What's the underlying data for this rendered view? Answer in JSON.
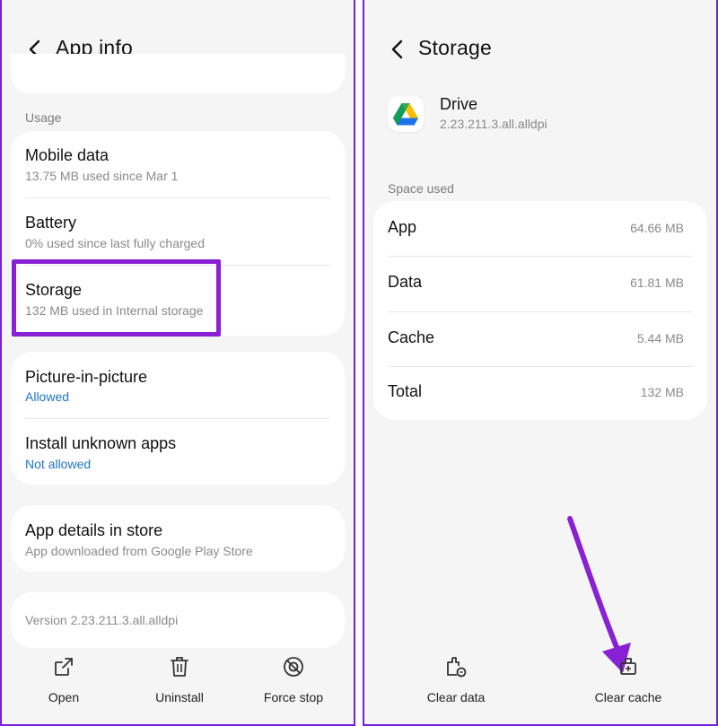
{
  "left": {
    "header": {
      "title": "App info"
    },
    "usage_label": "Usage",
    "usage_items": [
      {
        "title": "Mobile data",
        "subtitle": "13.75 MB used since Mar 1"
      },
      {
        "title": "Battery",
        "subtitle": "0% used since last fully charged"
      },
      {
        "title": "Storage",
        "subtitle": "132 MB used in Internal storage"
      }
    ],
    "perm_items": [
      {
        "title": "Picture-in-picture",
        "subtitle": "Allowed"
      },
      {
        "title": "Install unknown apps",
        "subtitle": "Not allowed"
      }
    ],
    "store_item": {
      "title": "App details in store",
      "subtitle": "App downloaded from Google Play Store"
    },
    "version": "Version 2.23.211.3.all.alldpi",
    "bottom_bar": {
      "open": "Open",
      "uninstall": "Uninstall",
      "force_stop": "Force stop"
    }
  },
  "right": {
    "header": {
      "title": "Storage"
    },
    "app": {
      "name": "Drive",
      "version": "2.23.211.3.all.alldpi"
    },
    "space_used_label": "Space used",
    "rows": [
      {
        "label": "App",
        "value": "64.66 MB"
      },
      {
        "label": "Data",
        "value": "61.81 MB"
      },
      {
        "label": "Cache",
        "value": "5.44 MB"
      },
      {
        "label": "Total",
        "value": "132 MB"
      }
    ],
    "bottom_bar": {
      "clear_data": "Clear data",
      "clear_cache": "Clear cache"
    }
  },
  "colors": {
    "highlight": "#8a20d4",
    "link_blue": "#1d74c9",
    "background": "#f5f5f6"
  },
  "icons": [
    "back-arrow-icon",
    "open-external-icon",
    "trash-icon",
    "force-stop-icon",
    "google-drive-icon",
    "clear-data-icon",
    "clear-cache-icon"
  ]
}
